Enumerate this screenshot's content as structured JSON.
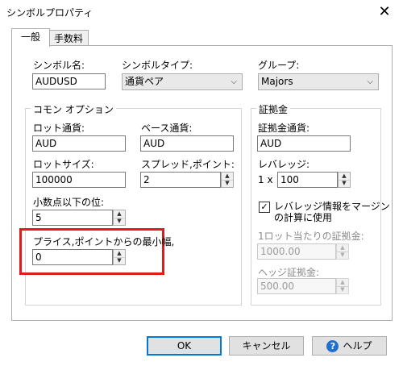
{
  "window": {
    "title": "シンボルプロパティ",
    "close_glyph": "✕"
  },
  "tabs": [
    {
      "label": "一般",
      "active": true
    },
    {
      "label": "手数料",
      "active": false
    }
  ],
  "symbol": {
    "name_label": "シンボル名:",
    "name_value": "AUDUSD",
    "type_label": "シンボルタイプ:",
    "type_value": "通貨ペア",
    "group_label": "グループ:",
    "group_value": "Majors"
  },
  "common_options": {
    "title": "コモン オプション",
    "lot_currency_label": "ロット通貨:",
    "lot_currency_value": "AUD",
    "base_currency_label": "ベース通貨:",
    "base_currency_value": "AUD",
    "lot_size_label": "ロットサイズ:",
    "lot_size_value": "100000",
    "spread_label": "スプレッド,ポイント:",
    "spread_value": "2",
    "decimals_label": "小数点以下の位:",
    "decimals_value": "5",
    "min_distance_label": "プライス,ポイントからの最小幅,",
    "min_distance_value": "0"
  },
  "margin": {
    "title": "証拠金",
    "currency_label": "証拠金通貨:",
    "currency_value": "AUD",
    "leverage_label": "レバレッジ:",
    "leverage_prefix": "1 x",
    "leverage_value": "100",
    "use_leverage_checked": true,
    "use_leverage_label_line1": "レバレッジ情報をマージン",
    "use_leverage_label_line2": "の計算に使用",
    "per_lot_label": "1ロット当たりの証拠金:",
    "per_lot_value": "1000.00",
    "hedge_label": "ヘッジ証拠金:",
    "hedge_value": "500.00"
  },
  "buttons": {
    "ok": "OK",
    "cancel": "キャンセル",
    "help": "ヘルプ",
    "help_icon_glyph": "?"
  },
  "icons": {
    "spin_up": "▲",
    "spin_down": "▼",
    "combo_arrow": "⌵",
    "check_glyph": "✓"
  },
  "colors": {
    "highlight": "#e01b1b",
    "primary_border": "#0078d7"
  }
}
